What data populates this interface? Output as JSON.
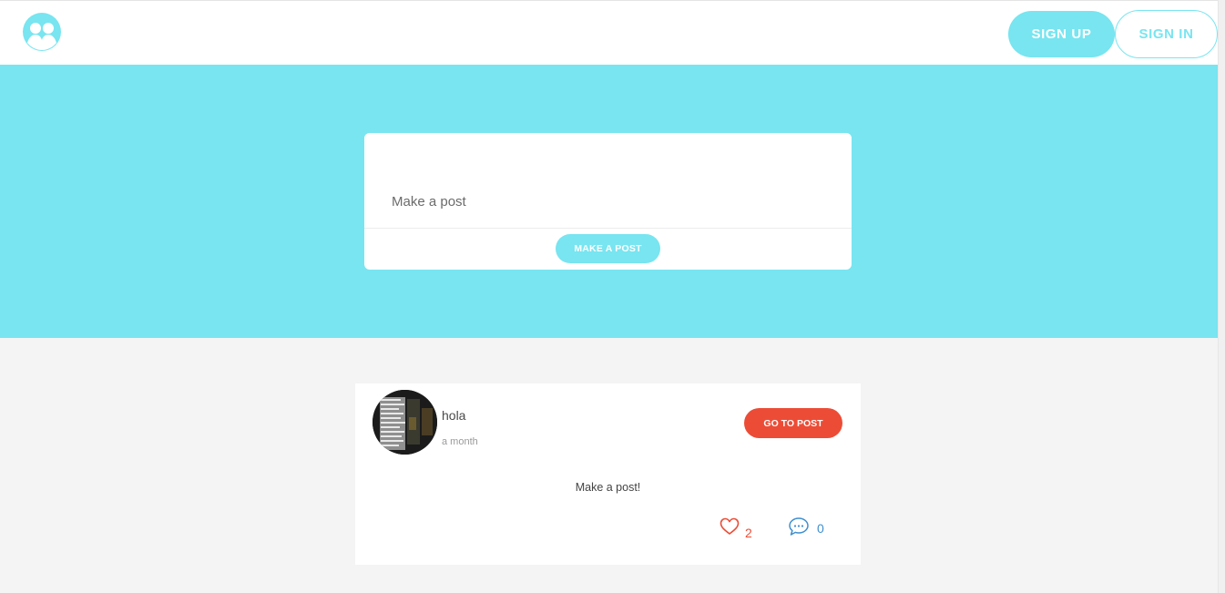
{
  "header": {
    "logo_icon": "users-circle-icon",
    "signup_label": "SIGN UP",
    "signin_label": "SIGN IN"
  },
  "composer": {
    "placeholder": "Make a post",
    "submit_label": "MAKE A POST"
  },
  "feed": {
    "posts": [
      {
        "author": "hola",
        "time": "a month",
        "go_label": "GO TO POST",
        "body": "Make a post!",
        "likes": "2",
        "comments": "0"
      }
    ]
  },
  "colors": {
    "accent": "#78e5f0",
    "danger": "#ec4c36",
    "comment": "#3e8fd0",
    "background": "#f4f4f4"
  }
}
